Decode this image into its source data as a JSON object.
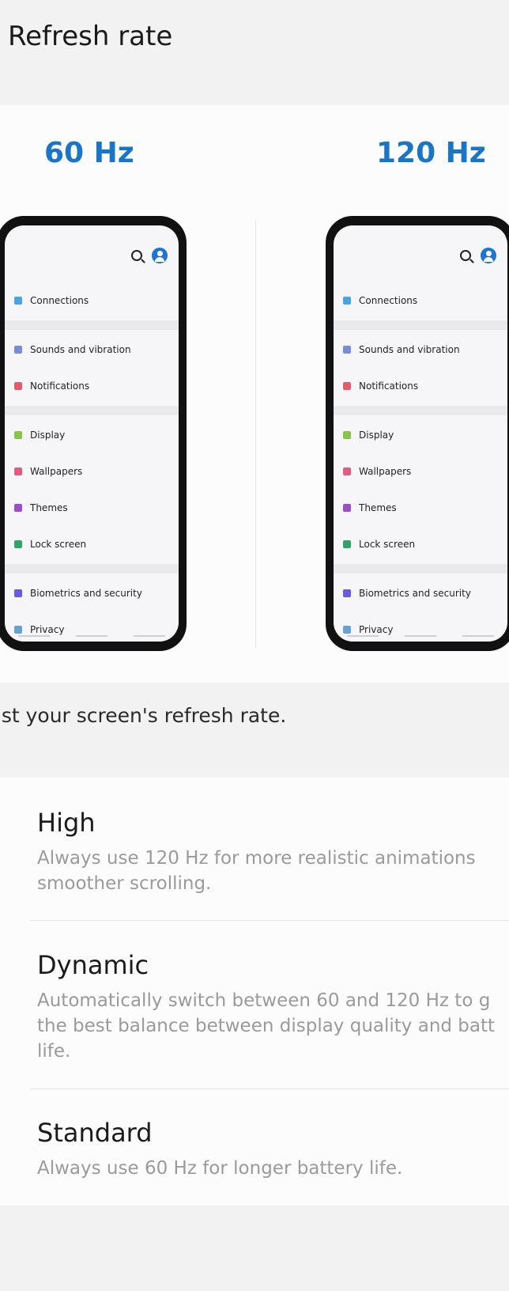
{
  "header": {
    "title": "Refresh rate"
  },
  "preview": {
    "left": {
      "label": "60 Hz",
      "items": [
        {
          "label": "Connections",
          "color": "#4aa3df"
        },
        {
          "label": "Sounds and vibration",
          "color": "#7a8cd6"
        },
        {
          "label": "Notifications",
          "color": "#e15d6b"
        },
        {
          "label": "Display",
          "color": "#8bc34a"
        },
        {
          "label": "Wallpapers",
          "color": "#e25b83"
        },
        {
          "label": "Themes",
          "color": "#9c4ec8"
        },
        {
          "label": "Lock screen",
          "color": "#2fa36b"
        },
        {
          "label": "Biometrics and security",
          "color": "#6a5bd6"
        },
        {
          "label": "Privacy",
          "color": "#6aa0d8"
        }
      ]
    },
    "right": {
      "label": "120 Hz",
      "items": [
        {
          "label": "Connections",
          "color": "#4aa3df"
        },
        {
          "label": "Sounds and vibration",
          "color": "#7a8cd6"
        },
        {
          "label": "Notifications",
          "color": "#e15d6b"
        },
        {
          "label": "Display",
          "color": "#8bc34a"
        },
        {
          "label": "Wallpapers",
          "color": "#e25b83"
        },
        {
          "label": "Themes",
          "color": "#9c4ec8"
        },
        {
          "label": "Lock screen",
          "color": "#2fa36b"
        },
        {
          "label": "Biometrics and security",
          "color": "#6a5bd6"
        },
        {
          "label": "Privacy",
          "color": "#6aa0d8"
        }
      ]
    }
  },
  "description": "ust your screen's refresh rate.",
  "options": [
    {
      "title": "High",
      "subtitle": "Always use 120 Hz for more realistic animations smoother scrolling."
    },
    {
      "title": "Dynamic",
      "subtitle": "Automatically switch between 60 and 120 Hz to g the best balance between display quality and batt life."
    },
    {
      "title": "Standard",
      "subtitle": "Always use 60 Hz for longer battery life."
    }
  ],
  "colors": {
    "accent": "#1a76c4",
    "background": "#f2f2f3",
    "card": "#fcfcfc"
  }
}
